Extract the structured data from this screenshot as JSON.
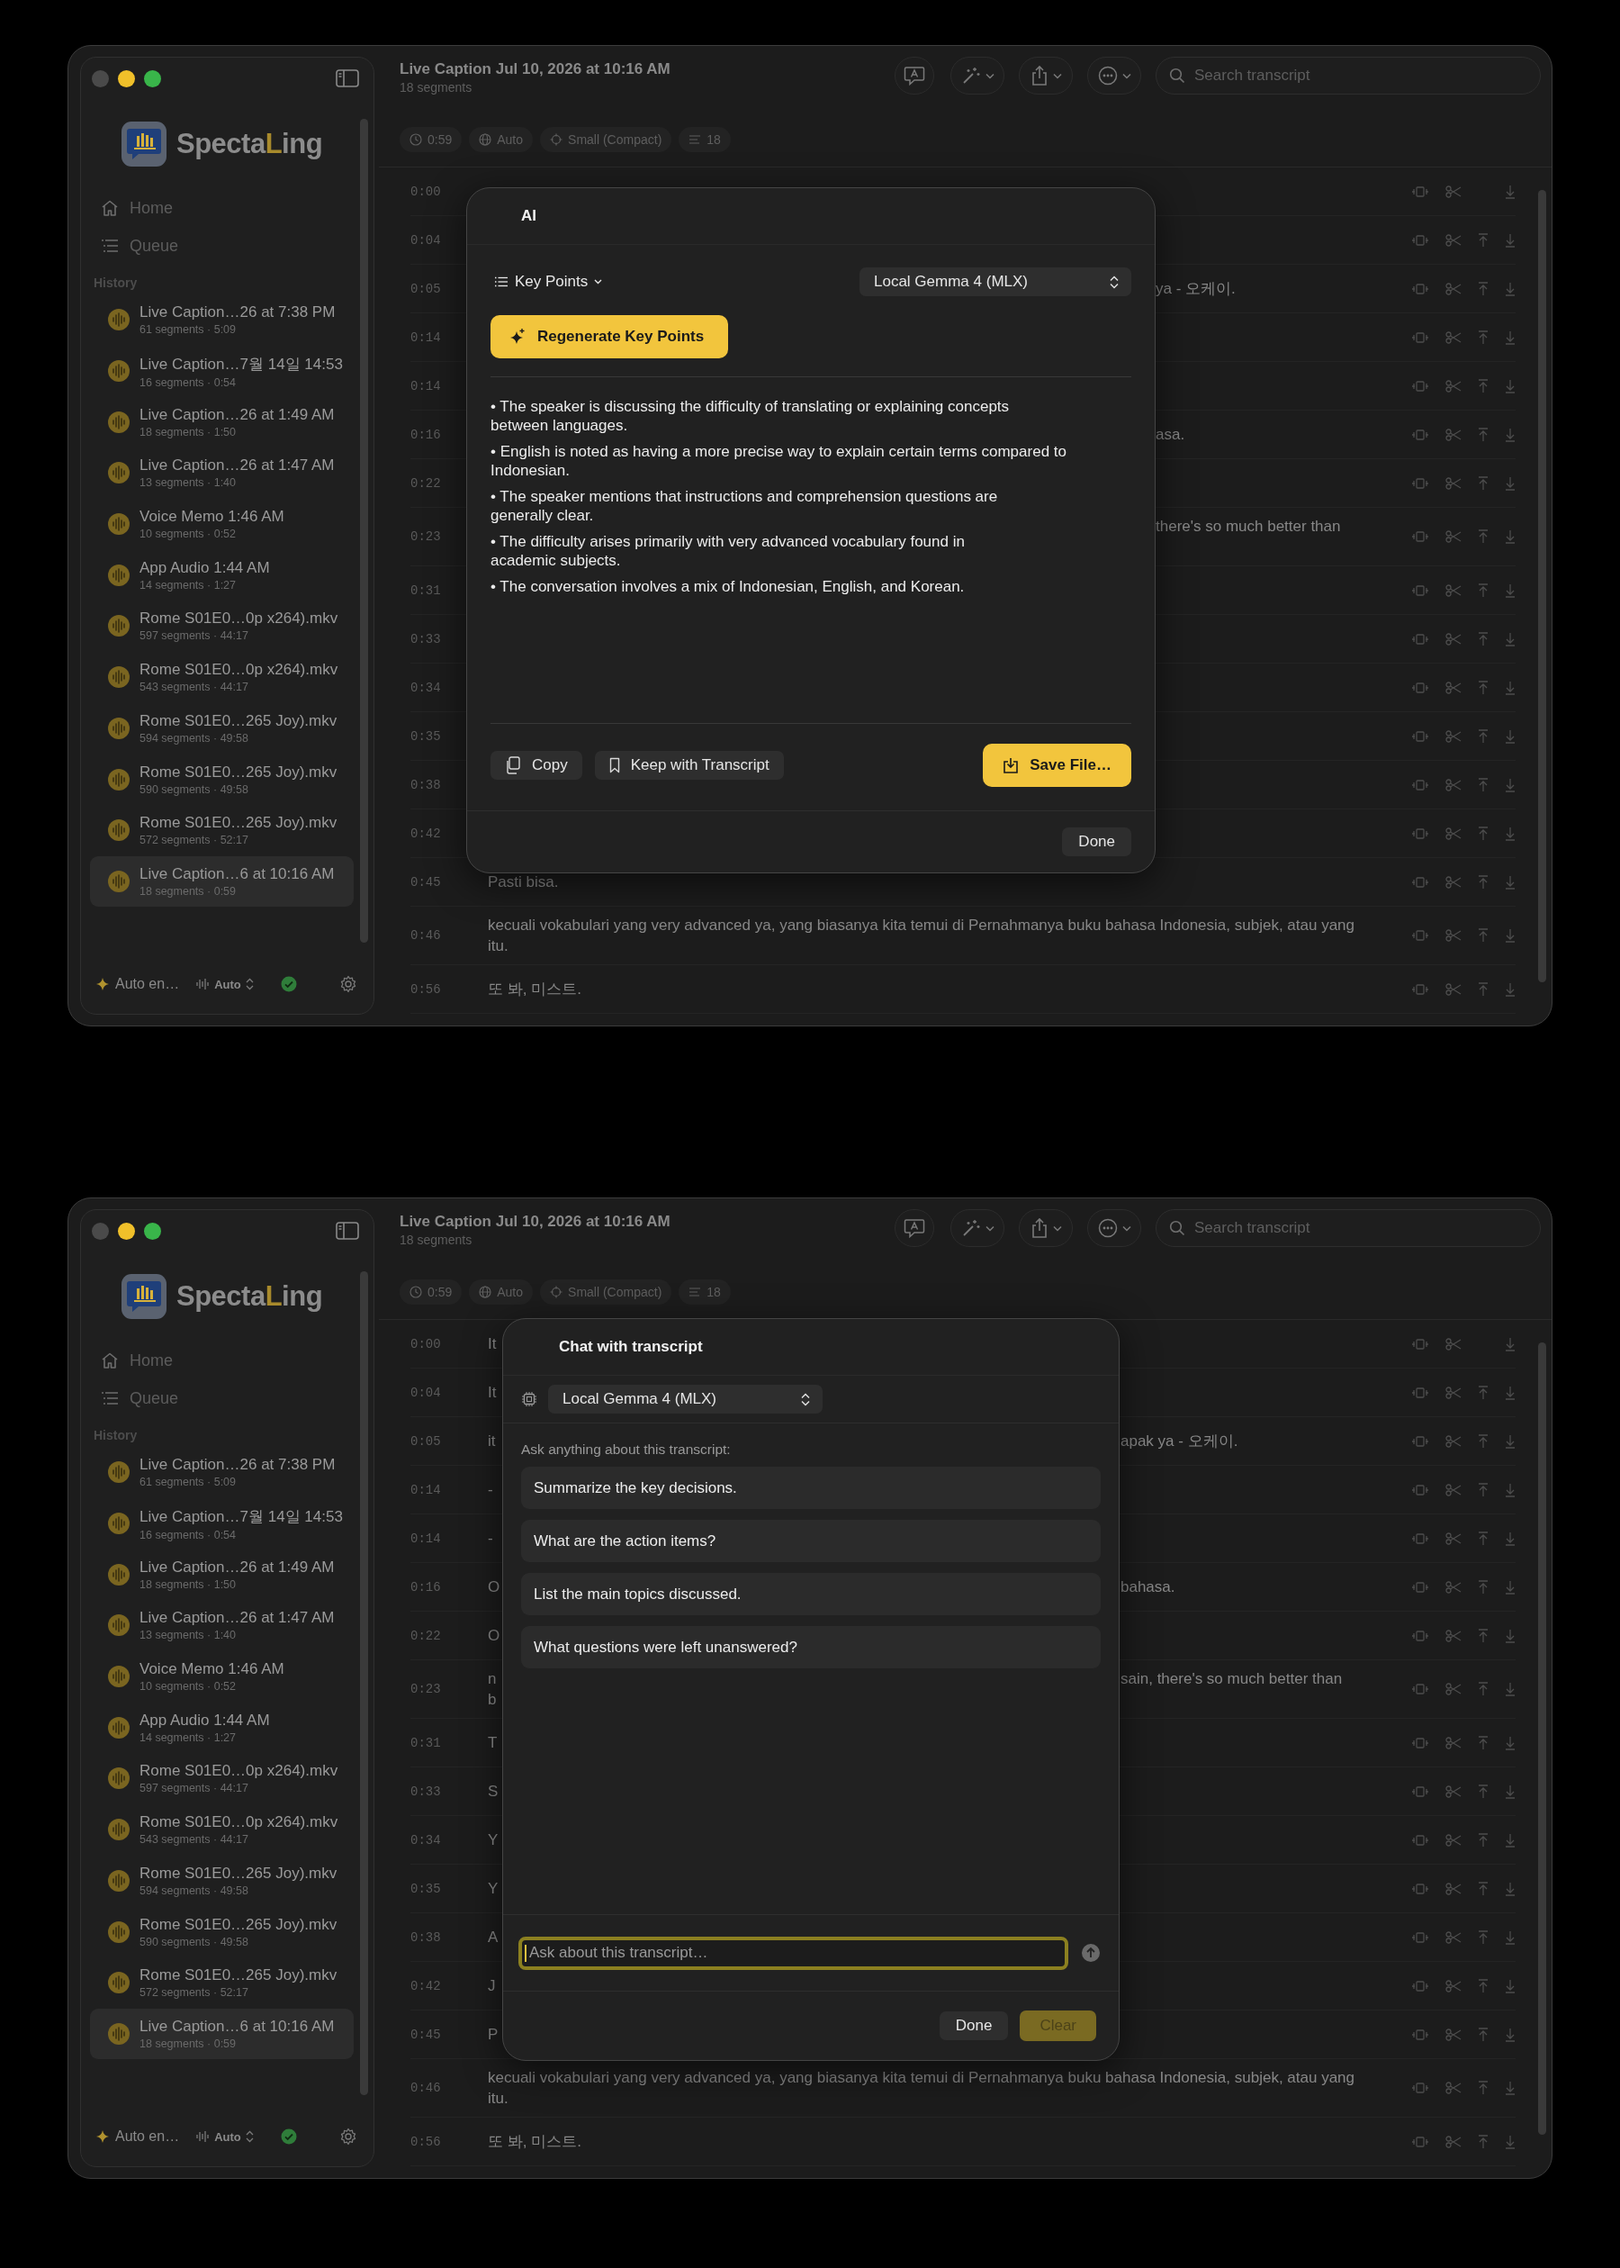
{
  "windows": [
    {
      "sidebar": {
        "logo": [
          {
            "text": "Specta",
            "accent": false
          },
          {
            "text": "L",
            "accent": true
          },
          {
            "text": "ing",
            "accent": false
          }
        ],
        "nav": [
          {
            "kind": "home",
            "label": "Home"
          },
          {
            "kind": "queue",
            "label": "Queue"
          }
        ],
        "history_label": "History",
        "history": [
          {
            "title": "Live Caption…26 at 7:38 PM",
            "meta": "61 segments · 5:09",
            "selected": false
          },
          {
            "title": "Live Caption…7월 14일 14:53",
            "meta": "16 segments · 0:54",
            "selected": false
          },
          {
            "title": "Live Caption…26 at 1:49 AM",
            "meta": "18 segments · 1:50",
            "selected": false
          },
          {
            "title": "Live Caption…26 at 1:47 AM",
            "meta": "13 segments · 1:40",
            "selected": false
          },
          {
            "title": "Voice Memo 1:46 AM",
            "meta": "10 segments · 0:52",
            "selected": false
          },
          {
            "title": "App Audio 1:44 AM",
            "meta": "14 segments · 1:27",
            "selected": false
          },
          {
            "title": "Rome S01E0…0p x264).mkv",
            "meta": "597 segments · 44:17",
            "selected": false
          },
          {
            "title": "Rome S01E0…0p x264).mkv",
            "meta": "543 segments · 44:17",
            "selected": false
          },
          {
            "title": "Rome S01E0…265 Joy).mkv",
            "meta": "594 segments · 49:58",
            "selected": false
          },
          {
            "title": "Rome S01E0…265 Joy).mkv",
            "meta": "590 segments · 49:58",
            "selected": false
          },
          {
            "title": "Rome S01E0…265 Joy).mkv",
            "meta": "572 segments · 52:17",
            "selected": false
          },
          {
            "title": "Live Caption…6 at 10:16 AM",
            "meta": "18 segments · 0:59",
            "selected": true
          }
        ],
        "footer": {
          "mode": "Auto en…",
          "source": "Auto"
        }
      },
      "header": {
        "title": "Live Caption Jul 10, 2026 at 10:16 AM",
        "subtitle": "18 segments",
        "search_placeholder": "Search transcript"
      },
      "chips": [
        {
          "kind": "duration",
          "label": "0:59"
        },
        {
          "kind": "language",
          "label": "Auto"
        },
        {
          "kind": "model",
          "label": "Small (Compact)"
        },
        {
          "kind": "segments",
          "label": "18"
        }
      ],
      "rows": [
        {
          "time": "0:00",
          "move_up": false
        },
        {
          "time": "0:04",
          "move_up": true
        },
        {
          "time": "0:05",
          "right": [
            "ya - 오케이."
          ],
          "move_up": true
        },
        {
          "time": "0:14",
          "move_up": true
        },
        {
          "time": "0:14",
          "move_up": true
        },
        {
          "time": "0:16",
          "right": [
            "asa."
          ],
          "move_up": true
        },
        {
          "time": "0:22",
          "move_up": true
        },
        {
          "time": "0:23",
          "right": [
            "there's so much better than"
          ],
          "wrapped": true,
          "move_up": true
        },
        {
          "time": "0:31",
          "move_up": true
        },
        {
          "time": "0:33",
          "move_up": true
        },
        {
          "time": "0:34",
          "move_up": true
        },
        {
          "time": "0:35",
          "move_up": true
        },
        {
          "time": "0:38",
          "move_up": true
        },
        {
          "time": "0:42",
          "move_up": true
        },
        {
          "time": "0:45",
          "text": "Pasti bisa.",
          "move_up": true
        },
        {
          "time": "0:46",
          "text": "kecuali vokabulari yang very advanced ya, yang biasanya kita temui di Pernahmanya buku bahasa Indonesia, subjek, atau yang itu.",
          "move_up": true
        },
        {
          "time": "0:56",
          "text": "또 봐, 미스트.",
          "move_up": true
        }
      ],
      "dialog": {
        "kind": "ai",
        "title": "AI",
        "mode": "Key Points",
        "model": "Local Gemma 4 (MLX)",
        "action": "Regenerate Key Points",
        "points": [
          "• The speaker is discussing the difficulty of translating or explaining concepts\nbetween languages.",
          "• English is noted as having a more precise way to explain certain terms compared to\nIndonesian.",
          "• The speaker mentions that instructions and comprehension questions are\ngenerally clear.",
          "• The difficulty arises primarily with very advanced vocabulary found in\nacademic subjects.",
          "• The conversation involves a mix of Indonesian, English, and Korean."
        ],
        "copy": "Copy",
        "keep": "Keep with Transcript",
        "save": "Save File…",
        "done": "Done"
      }
    },
    {
      "sidebar": {
        "logo": [
          {
            "text": "Specta",
            "accent": false
          },
          {
            "text": "L",
            "accent": true
          },
          {
            "text": "ing",
            "accent": false
          }
        ],
        "nav": [
          {
            "kind": "home",
            "label": "Home"
          },
          {
            "kind": "queue",
            "label": "Queue"
          }
        ],
        "history_label": "History",
        "history": [
          {
            "title": "Live Caption…26 at 7:38 PM",
            "meta": "61 segments · 5:09",
            "selected": false
          },
          {
            "title": "Live Caption…7월 14일 14:53",
            "meta": "16 segments · 0:54",
            "selected": false
          },
          {
            "title": "Live Caption…26 at 1:49 AM",
            "meta": "18 segments · 1:50",
            "selected": false
          },
          {
            "title": "Live Caption…26 at 1:47 AM",
            "meta": "13 segments · 1:40",
            "selected": false
          },
          {
            "title": "Voice Memo 1:46 AM",
            "meta": "10 segments · 0:52",
            "selected": false
          },
          {
            "title": "App Audio 1:44 AM",
            "meta": "14 segments · 1:27",
            "selected": false
          },
          {
            "title": "Rome S01E0…0p x264).mkv",
            "meta": "597 segments · 44:17",
            "selected": false
          },
          {
            "title": "Rome S01E0…0p x264).mkv",
            "meta": "543 segments · 44:17",
            "selected": false
          },
          {
            "title": "Rome S01E0…265 Joy).mkv",
            "meta": "594 segments · 49:58",
            "selected": false
          },
          {
            "title": "Rome S01E0…265 Joy).mkv",
            "meta": "590 segments · 49:58",
            "selected": false
          },
          {
            "title": "Rome S01E0…265 Joy).mkv",
            "meta": "572 segments · 52:17",
            "selected": false
          },
          {
            "title": "Live Caption…6 at 10:16 AM",
            "meta": "18 segments · 0:59",
            "selected": true
          }
        ],
        "footer": {
          "mode": "Auto en…",
          "source": "Auto"
        }
      },
      "header": {
        "title": "Live Caption Jul 10, 2026 at 10:16 AM",
        "subtitle": "18 segments",
        "search_placeholder": "Search transcript"
      },
      "chips": [
        {
          "kind": "duration",
          "label": "0:59"
        },
        {
          "kind": "language",
          "label": "Auto"
        },
        {
          "kind": "model",
          "label": "Small (Compact)"
        },
        {
          "kind": "segments",
          "label": "18"
        }
      ],
      "rows": [
        {
          "time": "0:00",
          "left": [
            "It"
          ],
          "move_up": false
        },
        {
          "time": "0:04",
          "left": [
            "It"
          ],
          "move_up": true
        },
        {
          "time": "0:05",
          "left": [
            "it"
          ],
          "right": [
            "apak ya - 오케이."
          ],
          "move_up": true
        },
        {
          "time": "0:14",
          "left": [
            "-"
          ],
          "move_up": true
        },
        {
          "time": "0:14",
          "left": [
            "-"
          ],
          "move_up": true
        },
        {
          "time": "0:16",
          "left": [
            "O"
          ],
          "right": [
            "bahasa."
          ],
          "move_up": true
        },
        {
          "time": "0:22",
          "left": [
            "O"
          ],
          "move_up": true
        },
        {
          "time": "0:23",
          "left": [
            "n",
            "b"
          ],
          "right": [
            "sain, there's so much better than"
          ],
          "move_up": true
        },
        {
          "time": "0:31",
          "left": [
            "T"
          ],
          "move_up": true
        },
        {
          "time": "0:33",
          "left": [
            "S"
          ],
          "move_up": true
        },
        {
          "time": "0:34",
          "left": [
            "Y"
          ],
          "move_up": true
        },
        {
          "time": "0:35",
          "left": [
            "Y"
          ],
          "move_up": true
        },
        {
          "time": "0:38",
          "left": [
            "A"
          ],
          "move_up": true
        },
        {
          "time": "0:42",
          "left": [
            "J"
          ],
          "move_up": true
        },
        {
          "time": "0:45",
          "left": [
            "P"
          ],
          "move_up": true
        },
        {
          "time": "0:46",
          "text": "kecuali vokabulari yang very advanced ya, yang biasanya kita temui di Pernahmanya buku bahasa Indonesia, subjek, atau yang itu.",
          "move_up": true
        },
        {
          "time": "0:56",
          "text": "또 봐, 미스트.",
          "move_up": true
        }
      ],
      "dialog": {
        "kind": "chat",
        "title": "Chat with transcript",
        "model": "Local Gemma 4 (MLX)",
        "prompt_label": "Ask anything about this transcript:",
        "suggestions": [
          "Summarize the key decisions.",
          "What are the action items?",
          "List the main topics discussed.",
          "What questions were left unanswered?"
        ],
        "input": {
          "placeholder": "Ask about this transcript…",
          "focused": true
        },
        "done": "Done",
        "clear": {
          "label": "Clear",
          "disabled": true
        }
      }
    }
  ]
}
